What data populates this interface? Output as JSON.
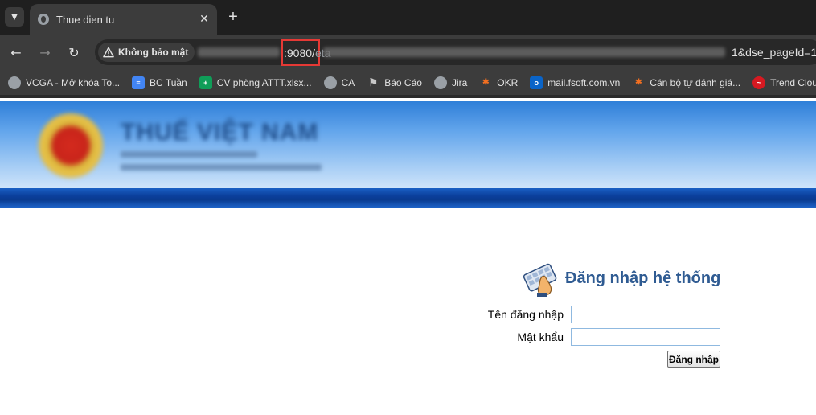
{
  "browser": {
    "tab_title": "Thue dien tu",
    "security_label": "Không bảo mật",
    "url_port_text": ":9080/",
    "url_port_rest": "eta",
    "url_tail": "1&dse_pageId=1",
    "bookmarks": [
      {
        "label": "VCGA - Mở khóa To...",
        "icon": "globe-icon"
      },
      {
        "label": "BC Tuần",
        "icon": "docs-icon"
      },
      {
        "label": "CV phòng ATTT.xlsx...",
        "icon": "sheets-icon"
      },
      {
        "label": "CA",
        "icon": "globe-icon"
      },
      {
        "label": "Báo Cáo",
        "icon": "flag-icon"
      },
      {
        "label": "Jira",
        "icon": "globe-icon"
      },
      {
        "label": "OKR",
        "icon": "fpt-icon"
      },
      {
        "label": "mail.fsoft.com.vn",
        "icon": "outlook-icon"
      },
      {
        "label": "Cán bộ tự đánh giá...",
        "icon": "fpt-icon"
      },
      {
        "label": "Trend Cloud",
        "icon": "trend-icon"
      }
    ]
  },
  "page": {
    "site_title": "THUẾ VIỆT NAM"
  },
  "login": {
    "title": "Đăng nhập hệ thống",
    "username_label": "Tên đăng nhập",
    "username_value": "",
    "password_label": "Mật khẩu",
    "password_value": "",
    "submit_label": "Đăng nhập"
  },
  "colors": {
    "login_title": "#2f5b92",
    "highlight_box": "#e53935",
    "input_border": "#8fb9e0"
  }
}
